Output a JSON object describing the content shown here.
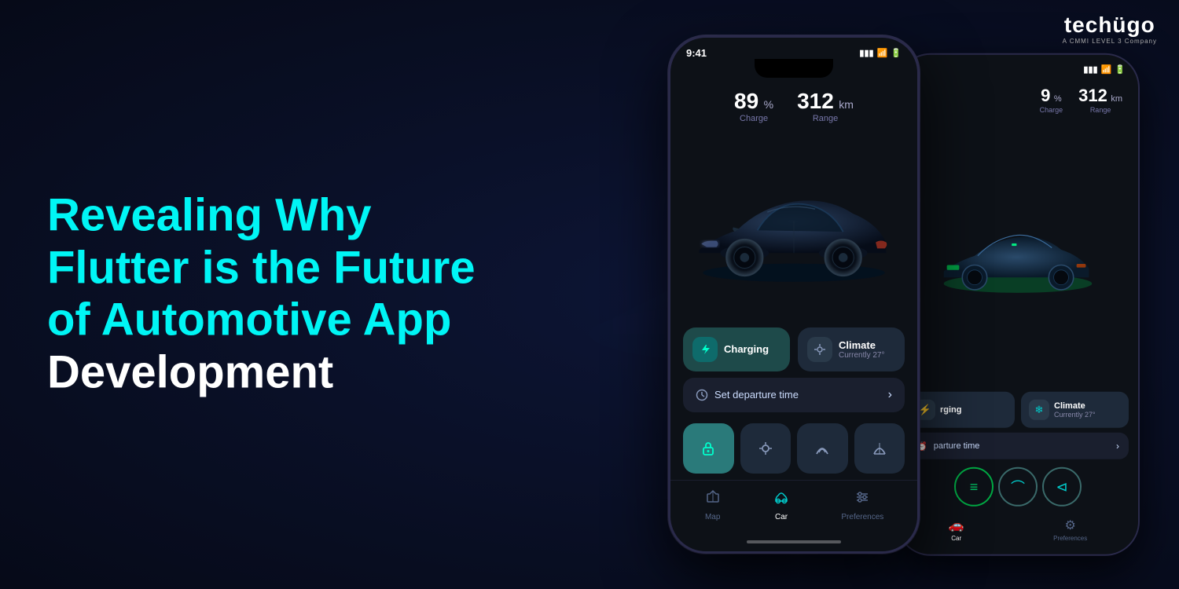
{
  "background": {
    "color": "#0a0e1f"
  },
  "logo": {
    "text": "techügo",
    "subtitle": "A CMMI LEVEL 3 Company"
  },
  "headline": {
    "line1": "Revealing Why",
    "line2": "Flutter is the Future",
    "line3": "of Automotive App",
    "line4": "Development"
  },
  "phone_front": {
    "status_bar": {
      "time": "9:41",
      "signal": "signal",
      "wifi": "wifi",
      "battery": "battery"
    },
    "stats": {
      "charge_value": "89",
      "charge_unit": "%",
      "charge_label": "Charge",
      "range_value": "312",
      "range_unit": "km",
      "range_label": "Range"
    },
    "controls": {
      "charging_label": "Charging",
      "climate_label": "Climate",
      "climate_sub": "Currently 27°"
    },
    "departure": {
      "label": "Set departure time"
    },
    "nav": {
      "map_label": "Map",
      "car_label": "Car",
      "preferences_label": "Preferences"
    }
  },
  "phone_back": {
    "stats": {
      "charge_value": "9",
      "charge_unit": "%",
      "charge_label": "Charge",
      "range_value": "312",
      "range_unit": "km",
      "range_label": "Range"
    },
    "controls": {
      "charging_label": "rging",
      "climate_label": "Climate",
      "climate_sub": "Currently 27°"
    },
    "departure": {
      "label": "parture time"
    },
    "nav": {
      "car_label": "Car",
      "preferences_label": "Preferences"
    }
  },
  "icons": {
    "charging": "⚡",
    "climate": "❄",
    "clock": "⏰",
    "lock": "🔓",
    "headlight": "💡",
    "wipers": "⌇",
    "mirror": "⊲",
    "map": "▷",
    "car": "🚗",
    "prefs": "⚙"
  }
}
